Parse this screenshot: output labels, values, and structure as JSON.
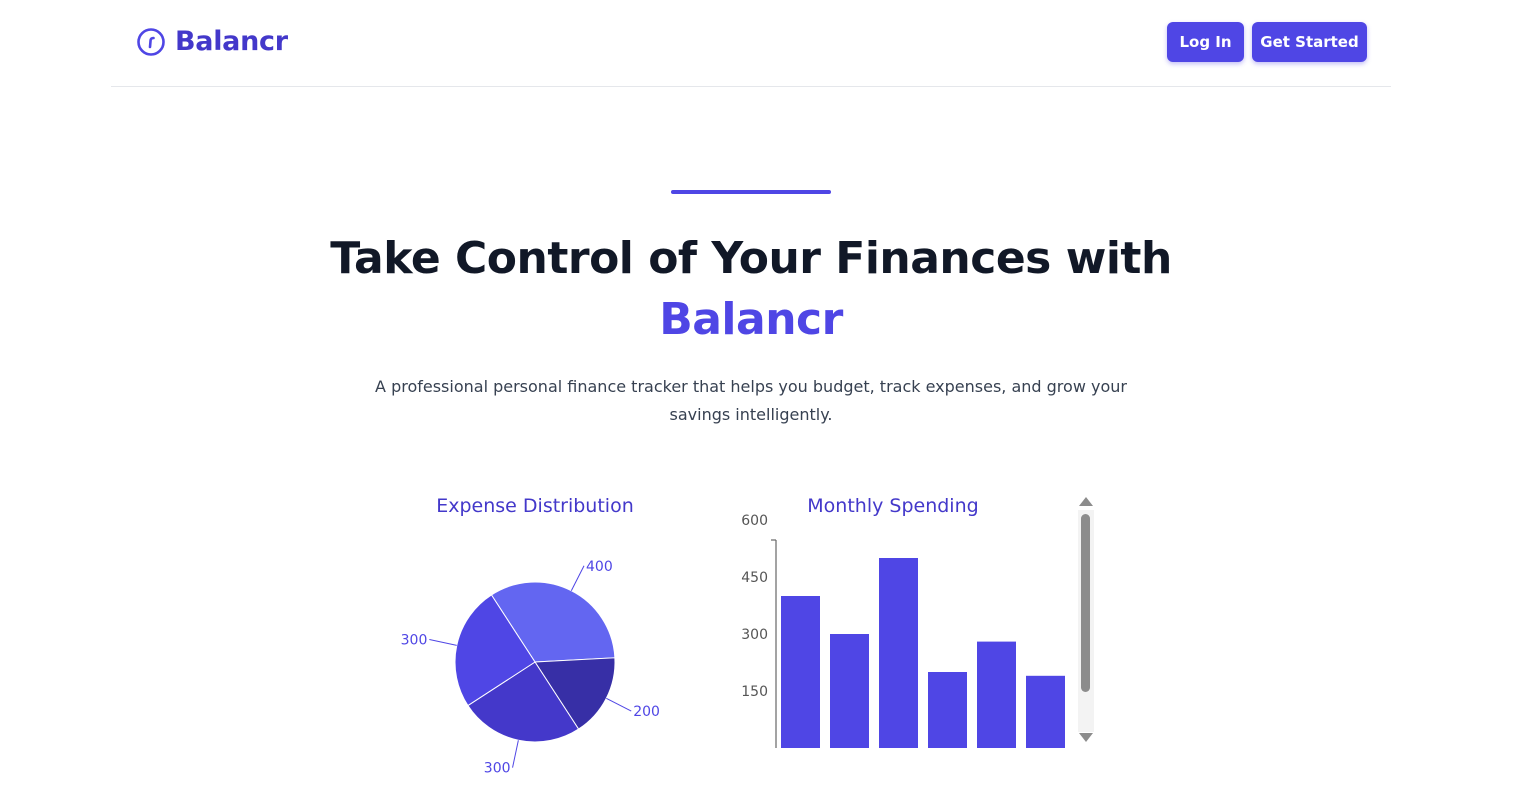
{
  "brand": {
    "name": "Balancr",
    "icon": "clock-icon"
  },
  "nav": {
    "login_label": "Log In",
    "start_label": "Get Started"
  },
  "hero": {
    "title": "Take Control of Your Finances with",
    "title_accent": "Balancr",
    "subtitle": "A professional personal finance tracker that helps you budget, track expenses, and grow your savings intelligently."
  },
  "colors": {
    "accent": "#4f46e5",
    "brand": "#4338ca",
    "pie_colors": [
      "#6366f1",
      "#372fa6",
      "#4438ca",
      "#4f46e5"
    ]
  },
  "chart_data": [
    {
      "type": "pie",
      "title": "Expense Distribution",
      "values": [
        400,
        200,
        300,
        300
      ],
      "labels": [
        "400",
        "200",
        "300",
        "300"
      ]
    },
    {
      "type": "bar",
      "title": "Monthly Spending",
      "values": [
        400,
        300,
        500,
        200,
        280,
        190
      ],
      "yticks": [
        150,
        300,
        450,
        600
      ],
      "ylim": [
        0,
        600
      ]
    }
  ]
}
